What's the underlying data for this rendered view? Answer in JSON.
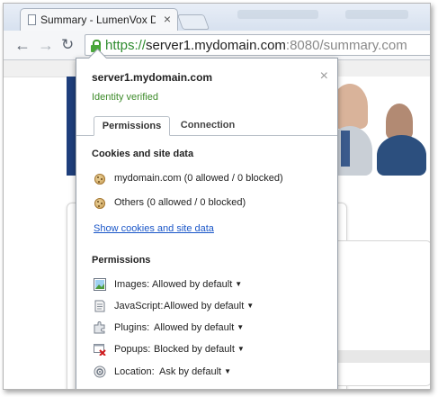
{
  "browser": {
    "tab_title": "Summary - LumenVox Da",
    "tab_close": "×",
    "url_scheme": "https://",
    "url_host": "server1.mydomain.com",
    "url_rest": ":8080/summary.com"
  },
  "popup": {
    "domain": "server1.mydomain.com",
    "close": "×",
    "identity": "Identity verified",
    "tabs": [
      "Permissions",
      "Connection"
    ],
    "cookies_title": "Cookies and site data",
    "cookies": [
      {
        "site": "mydomain.com",
        "counts": "(0 allowed / 0 blocked)"
      },
      {
        "site": "Others",
        "counts": "(0 allowed / 0 blocked)"
      }
    ],
    "show_cookies_link": "Show cookies and site data",
    "permissions_title": "Permissions",
    "permissions": [
      {
        "icon": "image-icon",
        "label": "Images:",
        "value": "Allowed by default"
      },
      {
        "icon": "javascript-icon",
        "label": "JavaScript:",
        "value": "Allowed by default"
      },
      {
        "icon": "plugin-icon",
        "label": "Plugins:",
        "value": "Allowed by default"
      },
      {
        "icon": "popup-blocked-icon",
        "label": "Popups:",
        "value": "Blocked by default"
      },
      {
        "icon": "location-icon",
        "label": "Location:",
        "value": "Ask by default"
      }
    ]
  },
  "colors": {
    "secure_green": "#2e8b2e",
    "link_blue": "#1a56c8",
    "banner_navy": "#1f3f7c"
  }
}
